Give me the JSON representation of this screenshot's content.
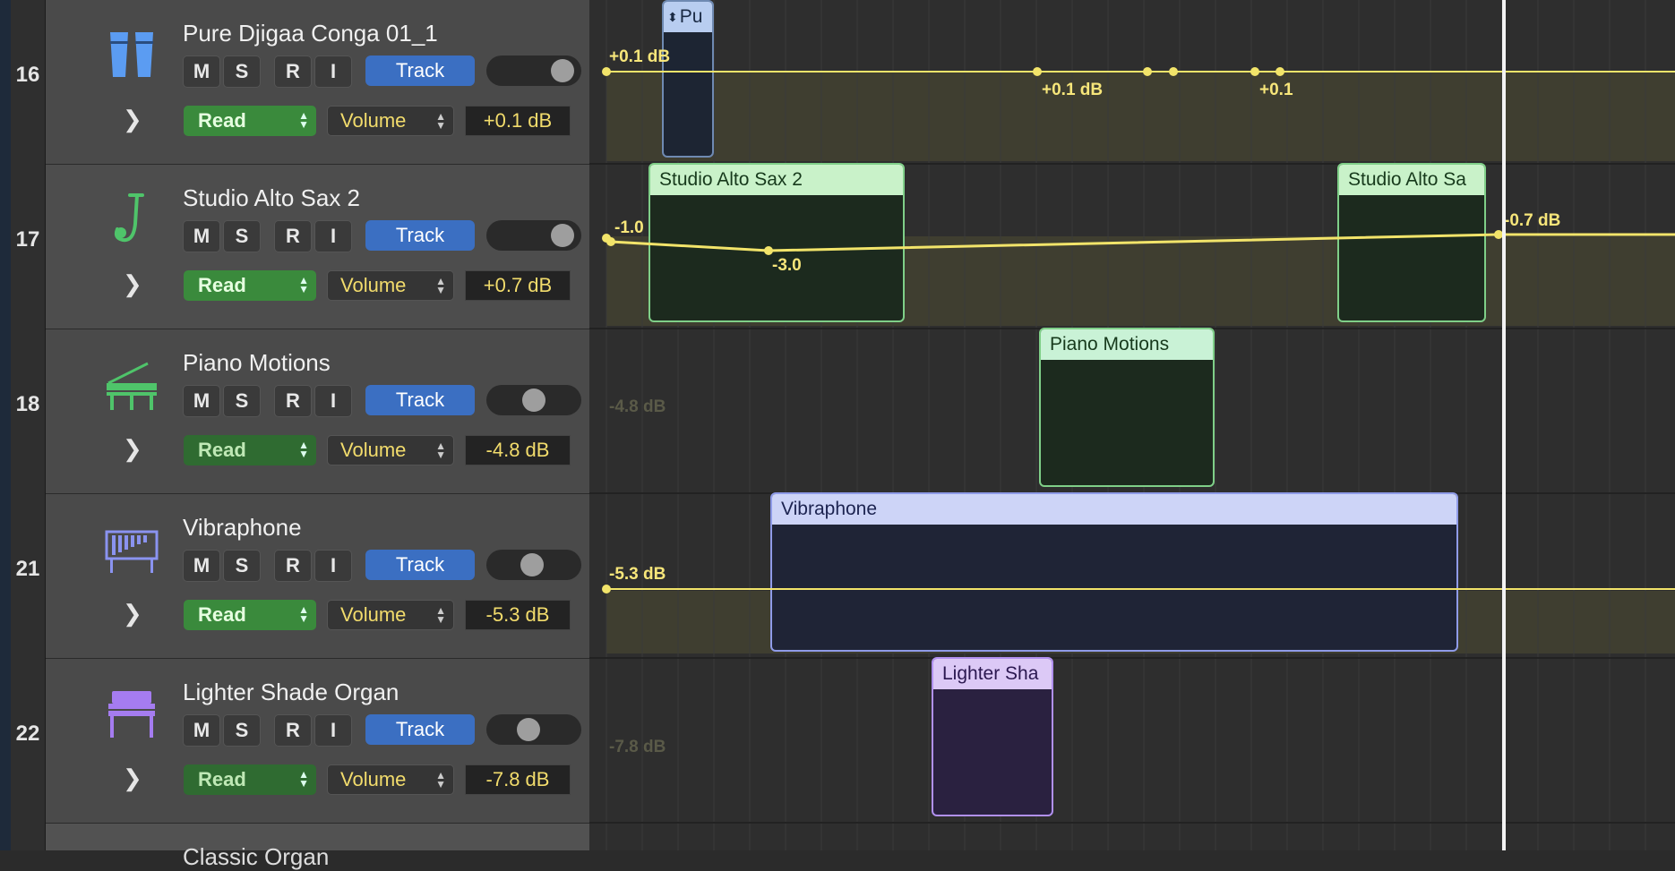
{
  "tracks": [
    {
      "number": "16",
      "name": "Pure Djigaa Conga 01_1",
      "icon": "conga-icon",
      "icon_color": "#5b9cf2",
      "buttons": {
        "mute": "M",
        "solo": "S",
        "record": "R",
        "input": "I",
        "track": "Track"
      },
      "automation_mode": "Read",
      "parameter": "Volume",
      "value": "+0.1 dB"
    },
    {
      "number": "17",
      "name": "Studio Alto Sax 2",
      "icon": "saxophone-icon",
      "icon_color": "#4fc46a",
      "buttons": {
        "mute": "M",
        "solo": "S",
        "record": "R",
        "input": "I",
        "track": "Track"
      },
      "automation_mode": "Read",
      "parameter": "Volume",
      "value": "+0.7 dB"
    },
    {
      "number": "18",
      "name": "Piano Motions",
      "icon": "grand-piano-icon",
      "icon_color": "#4fc46a",
      "buttons": {
        "mute": "M",
        "solo": "S",
        "record": "R",
        "input": "I",
        "track": "Track"
      },
      "automation_mode": "Read",
      "parameter": "Volume",
      "value": "-4.8 dB"
    },
    {
      "number": "21",
      "name": "Vibraphone",
      "icon": "vibraphone-icon",
      "icon_color": "#8a93f0",
      "buttons": {
        "mute": "M",
        "solo": "S",
        "record": "R",
        "input": "I",
        "track": "Track"
      },
      "automation_mode": "Read",
      "parameter": "Volume",
      "value": "-5.3 dB"
    },
    {
      "number": "22",
      "name": "Lighter Shade Organ",
      "icon": "organ-icon",
      "icon_color": "#a57cf0",
      "buttons": {
        "mute": "M",
        "solo": "S",
        "record": "R",
        "input": "I",
        "track": "Track"
      },
      "automation_mode": "Read",
      "parameter": "Volume",
      "value": "-7.8 dB"
    }
  ],
  "partial_track_name": "Classic Organ",
  "regions": {
    "conga": "Pu",
    "sax_a": "Studio Alto Sax 2",
    "sax_b": "Studio Alto Sa",
    "piano": "Piano Motions",
    "vibraphone": "Vibraphone",
    "organ": "Lighter Sha"
  },
  "automation_labels": {
    "conga_start": "+0.1 dB",
    "conga_mid": "+0.1 dB",
    "conga_end": "+0.1",
    "sax_start": "-1.0",
    "sax_dip": "-3.0",
    "sax_end": "-0.7 dB",
    "piano_ghost": "-4.8 dB",
    "vibraphone": "-5.3 dB",
    "organ_ghost": "-7.8 dB"
  },
  "colors": {
    "automation": "#f2e46a",
    "track_button": "#3b6fc2",
    "read_button": "#3a8a3c"
  }
}
